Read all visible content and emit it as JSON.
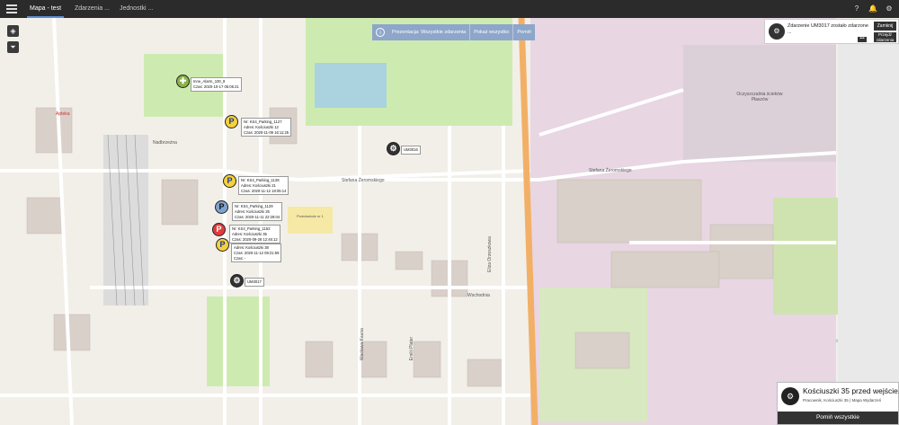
{
  "topbar": {
    "tabs": [
      {
        "label": "Mapa - test",
        "active": true
      },
      {
        "label": "Zdarzenia ...",
        "active": false
      },
      {
        "label": "Jednostki ...",
        "active": false
      }
    ],
    "icons": [
      "help-icon",
      "bell-icon",
      "settings-icon"
    ]
  },
  "filter_bar": {
    "info_icon": "info-icon",
    "segment_1": "Prezentacja: Wszystkie zdarzenia",
    "segment_2": "Pokaż wszystko",
    "segment_3": "Pomiń"
  },
  "notification": {
    "text": "Zdarzenie UM3017 zostało zdarzone ...",
    "close_label": "Zamknij",
    "view_label": "Przejdź zdarzenia",
    "more_label": "•••"
  },
  "map_labels": {
    "district": "Oczyszczalnia ścieków Płaszów",
    "street_1": "Stefana Żeromskiego",
    "street_2": "Wschodnia",
    "street_3": "Nadbrzeżna",
    "street_4": "Eliza Orzeszkowa",
    "street_5": "Wacława Kauna",
    "street_6": "Emilii Plater",
    "place_1": "Przedszkole nr 1",
    "place_2": "Apteka"
  },
  "markers": [
    {
      "id": "m1",
      "label": "Inne_Alarm_100_8",
      "callout": [
        "Inne_Alarm_100_8",
        "Czas: 2020-10-17 05:05:21"
      ]
    },
    {
      "id": "m2",
      "label": "P",
      "callout": [
        "Nr: KS4_Parking_1127",
        "Adres: Kościuszki 12",
        "Czas: 2020-11-09 16:11:25"
      ]
    },
    {
      "id": "m3",
      "label": "UM3016",
      "callout": [
        "UM3016"
      ]
    },
    {
      "id": "m4",
      "label": "P",
      "callout": [
        "Nr: KS4_Parking_1128",
        "Adres: Kościuszki 21",
        "Czas: 2020-11-12 18:05:14"
      ]
    },
    {
      "id": "m5",
      "label": "P",
      "callout": [
        "Nr: KS4_Parking_1129",
        "Adres: Kościuszki 25",
        "Czas: 2020-11-11 22:28:04"
      ]
    },
    {
      "id": "m6",
      "label": "P",
      "callout": [
        "Nr: KS4_Parking_1152",
        "Adres: Kościuszki 35",
        "Czas: 2020-09-28 12:46:12"
      ]
    },
    {
      "id": "m7",
      "label": "P",
      "callout": [
        "Adres: Kościuszki 38",
        "Czas: 2020-11-12 08:21:59",
        "Czas: -"
      ]
    },
    {
      "id": "m8",
      "label": "UM3017",
      "callout": [
        "UM3017"
      ]
    }
  ],
  "bottom_card": {
    "title": "Kościuszki 35 przed wejście...",
    "subtitle": "Pracownik, Kościuszki 35 | Mapa Wydarzeń",
    "dismiss_label": "Pomiń wszystkie"
  },
  "colors": {
    "topbar": "#2b2b2b",
    "filter_bar": "#8ea6c9",
    "marker_parking": "#f4d13d",
    "marker_alert": "#e23b3b"
  }
}
